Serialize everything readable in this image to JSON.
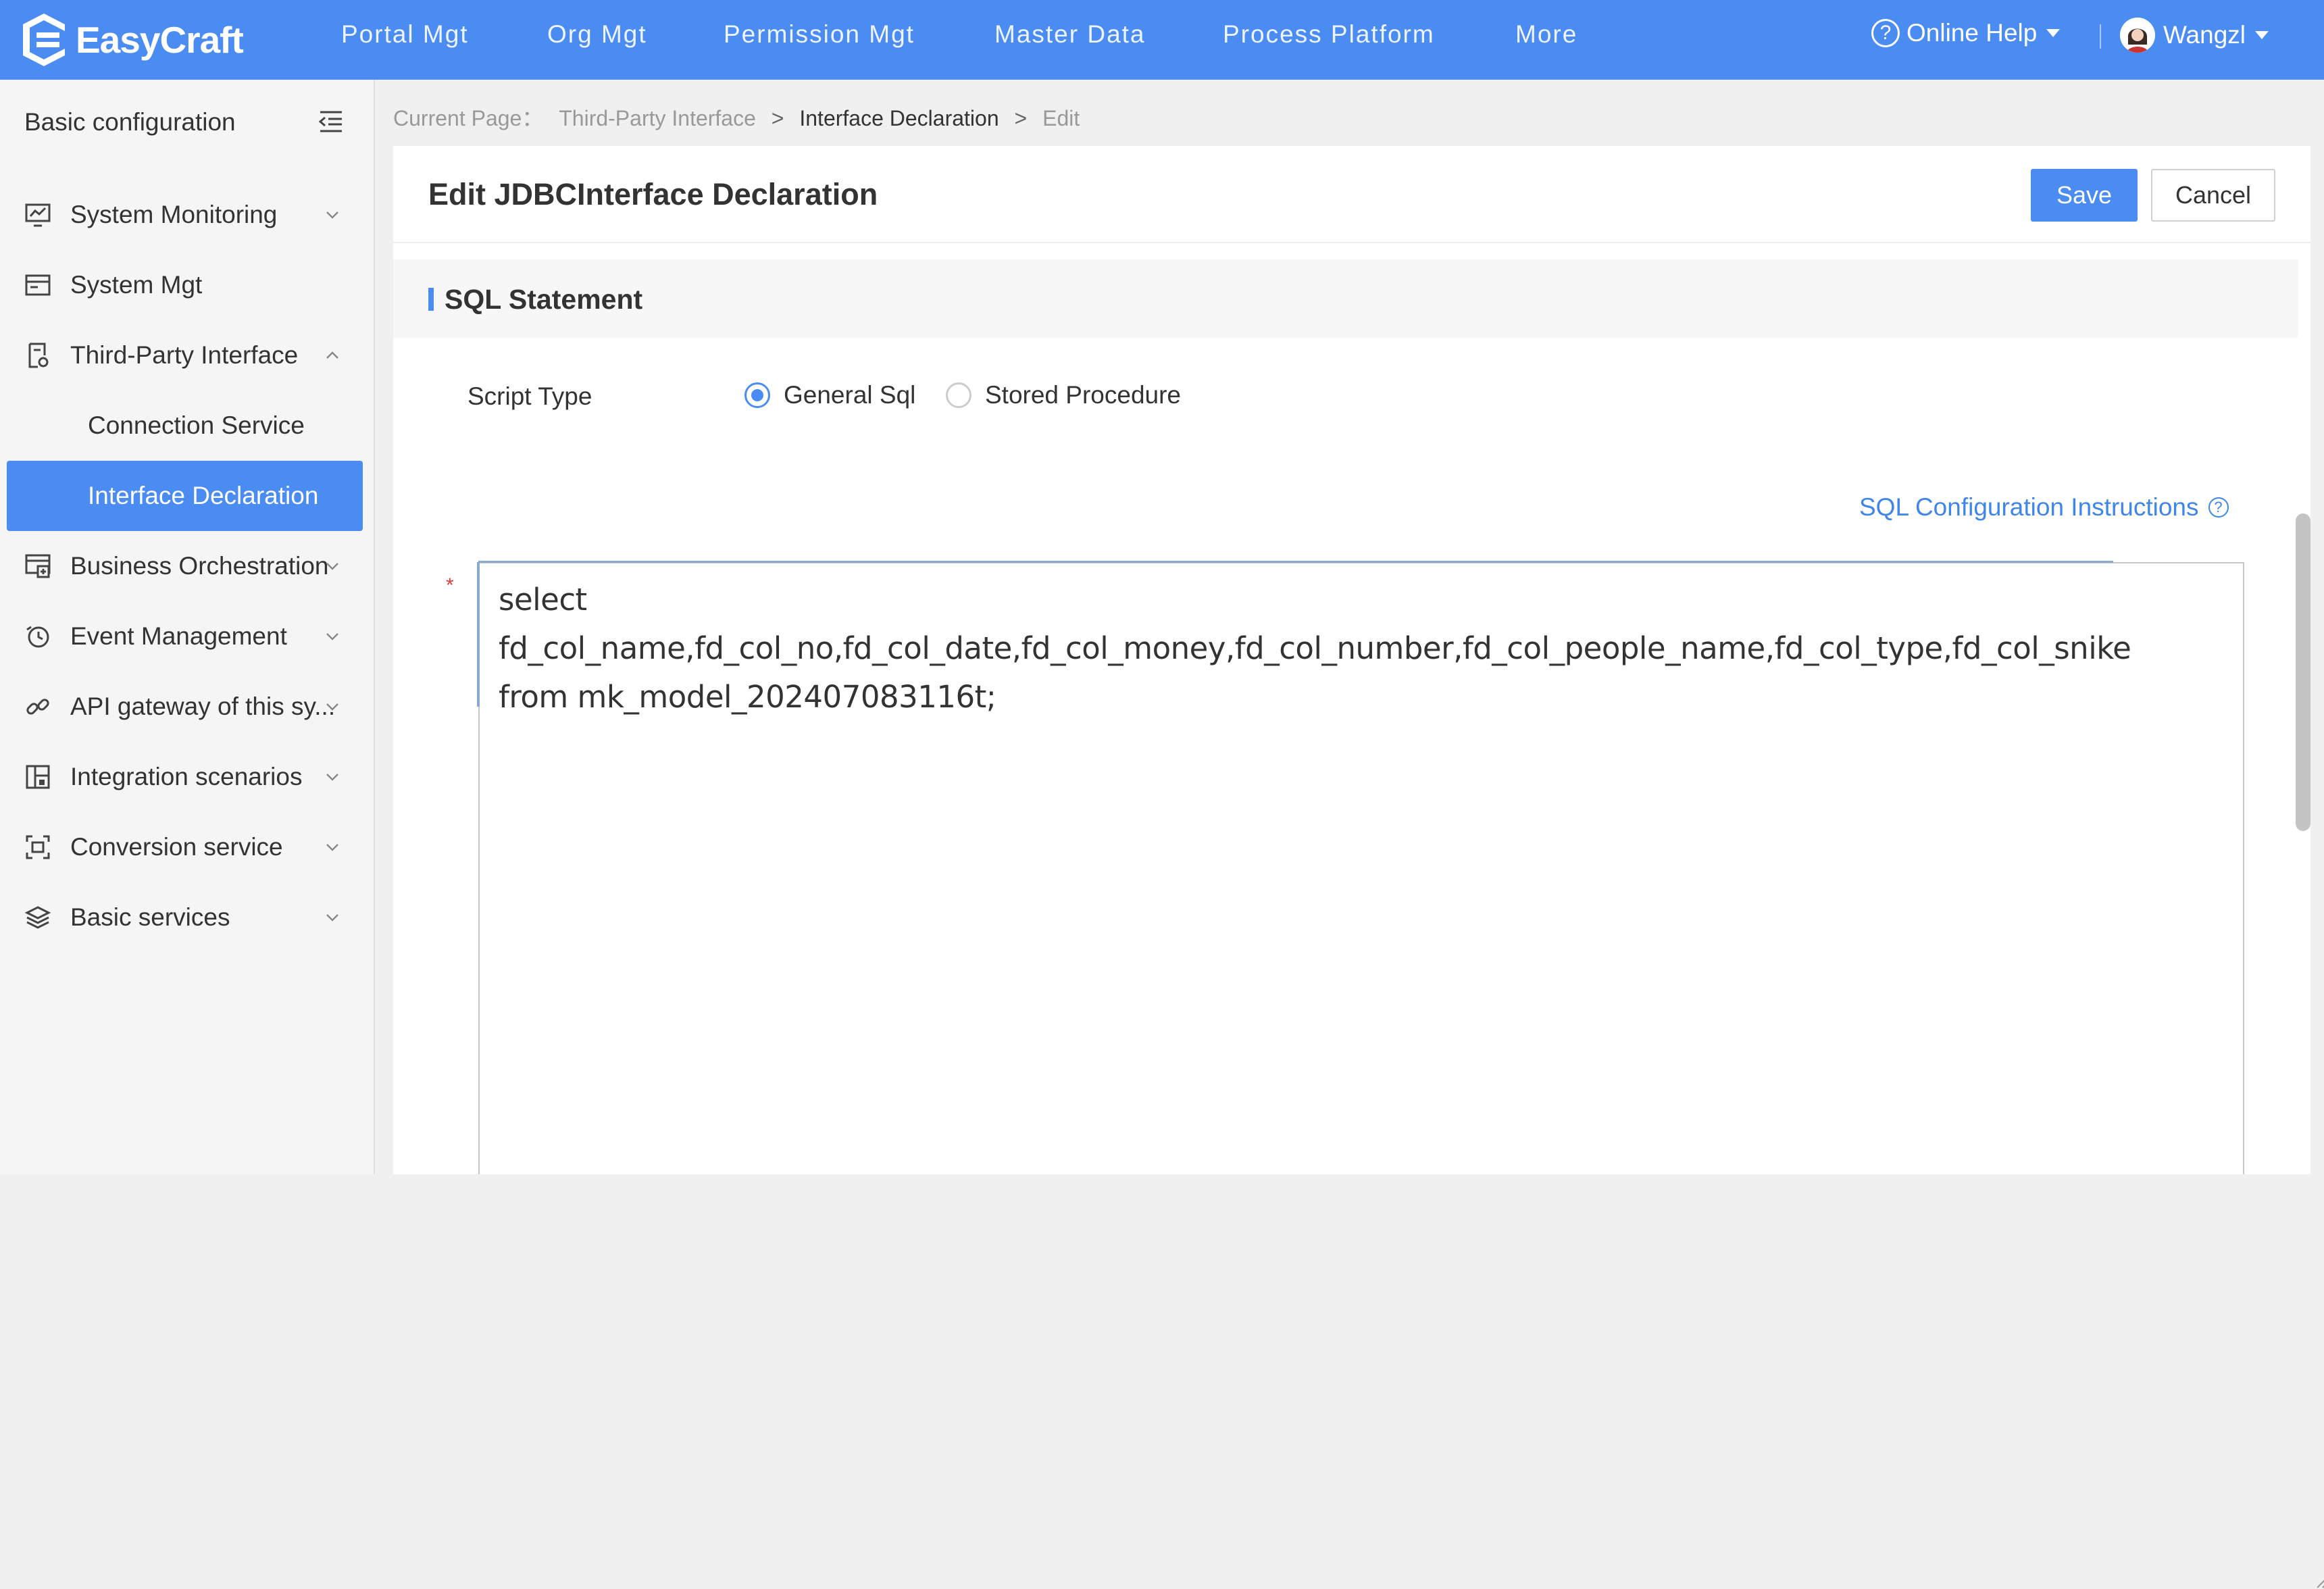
{
  "app": {
    "name": "EasyCraft"
  },
  "topnav": {
    "items": [
      "Portal Mgt",
      "Org Mgt",
      "Permission Mgt",
      "Master Data",
      "Process Platform",
      "More"
    ],
    "help_label": "Online Help",
    "user_name": "Wangzl"
  },
  "sidebar": {
    "header": "Basic configuration",
    "items": [
      {
        "label": "System Monitoring",
        "icon": "monitor-chart-icon"
      },
      {
        "label": "System Mgt",
        "icon": "window-icon"
      },
      {
        "label": "Third-Party Interface",
        "icon": "document-gear-icon"
      },
      {
        "label": "Connection Service"
      },
      {
        "label": "Interface Declaration"
      },
      {
        "label": "Business Orchestration",
        "icon": "orchestration-icon"
      },
      {
        "label": "Event Management",
        "icon": "clock-icon"
      },
      {
        "label": "API gateway of this sy...",
        "icon": "link-icon"
      },
      {
        "label": "Integration scenarios",
        "icon": "grid-icon"
      },
      {
        "label": "Conversion service",
        "icon": "convert-icon"
      },
      {
        "label": "Basic services",
        "icon": "layers-icon"
      }
    ]
  },
  "breadcrumb": {
    "prefix": "Current Page：",
    "items": [
      "Third-Party Interface",
      "Interface Declaration",
      "Edit"
    ],
    "sep": ">"
  },
  "page": {
    "title": "Edit JDBCInterface Declaration",
    "save_label": "Save",
    "cancel_label": "Cancel"
  },
  "section": {
    "title": "SQL Statement"
  },
  "form": {
    "script_type_label": "Script Type",
    "options": [
      "General Sql",
      "Stored Procedure"
    ],
    "selected": "General Sql",
    "required_mark": "*",
    "sql_help_link": "SQL Configuration Instructions",
    "sql_value": "select fd_col_name,fd_col_no,fd_col_date,fd_col_money,fd_col_number,fd_col_people_name,fd_col_type,fd_col_snike\nfrom mk_model_202407083116t;"
  },
  "colors": {
    "accent": "#4a8cf1",
    "link": "#3f86e8",
    "required": "#e03c3c"
  }
}
